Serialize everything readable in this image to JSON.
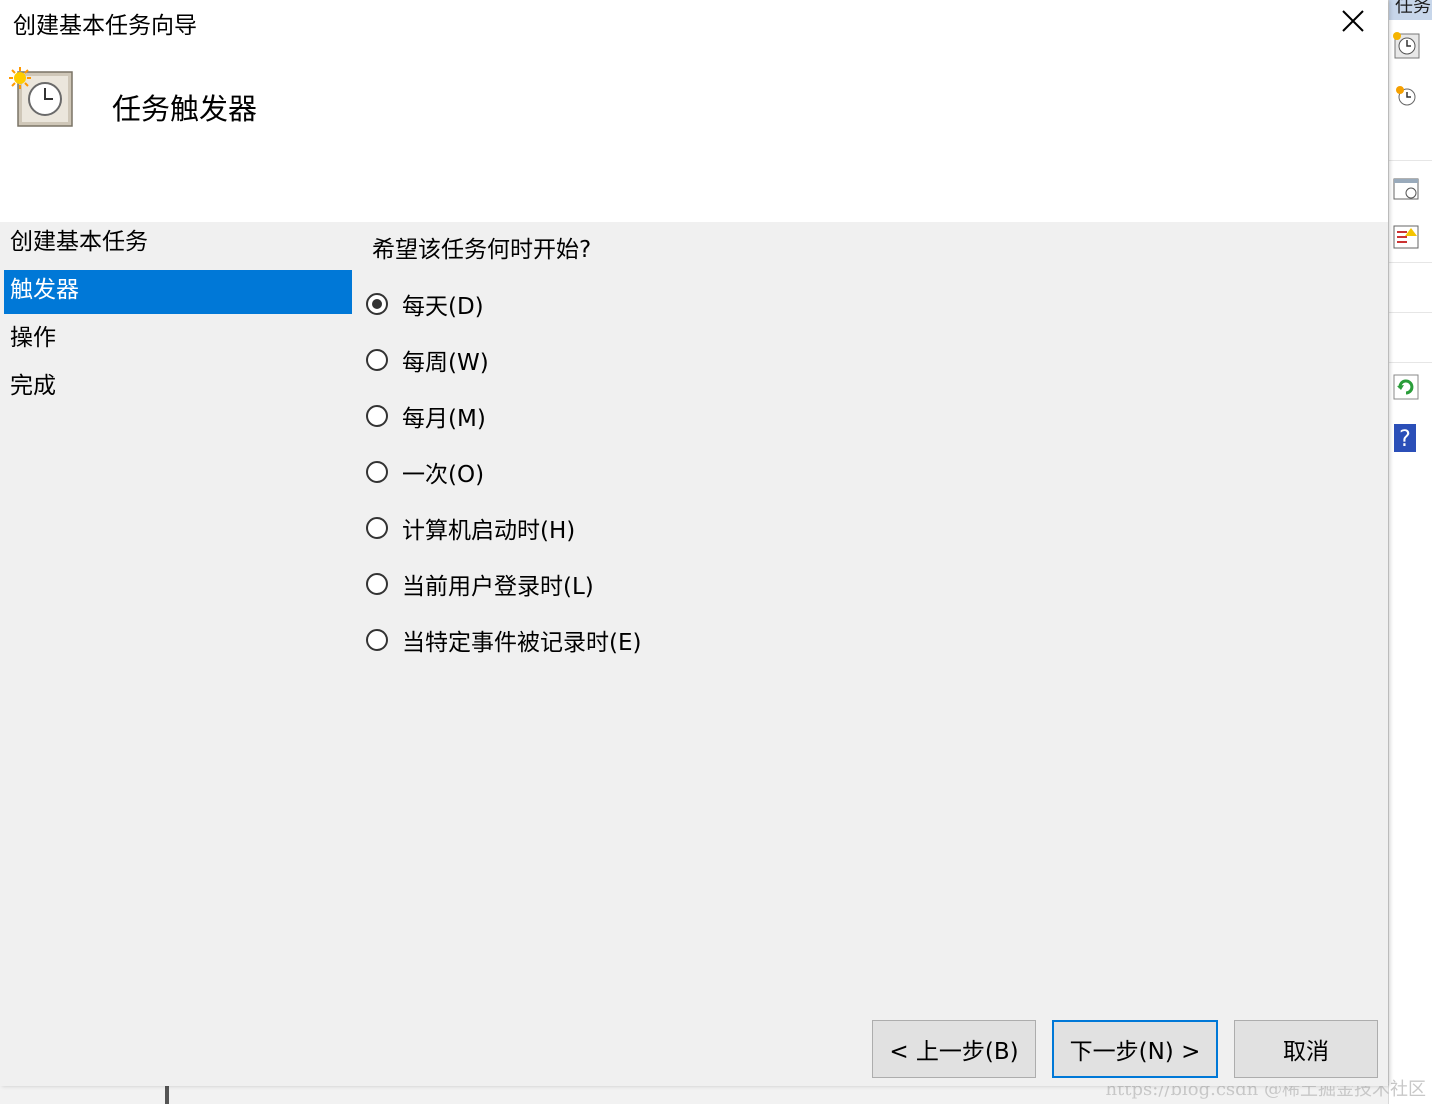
{
  "dialog": {
    "title": "创建基本任务向导",
    "header_title": "任务触发器"
  },
  "steps": [
    {
      "label": "创建基本任务",
      "active": false
    },
    {
      "label": "触发器",
      "active": true
    },
    {
      "label": "操作",
      "active": false
    },
    {
      "label": "完成",
      "active": false
    }
  ],
  "content": {
    "question": "希望该任务何时开始?",
    "options": [
      {
        "label": "每天(D)",
        "checked": true
      },
      {
        "label": "每周(W)",
        "checked": false
      },
      {
        "label": "每月(M)",
        "checked": false
      },
      {
        "label": "一次(O)",
        "checked": false
      },
      {
        "label": "计算机启动时(H)",
        "checked": false
      },
      {
        "label": "当前用户登录时(L)",
        "checked": false
      },
      {
        "label": "当特定事件被记录时(E)",
        "checked": false
      }
    ]
  },
  "buttons": {
    "back": "< 上一步(B)",
    "next": "下一步(N) >",
    "cancel": "取消"
  },
  "background_app": {
    "title_fragment": "任务"
  },
  "watermark": "https://blog.csdn @稀土掘金技术社区",
  "colors": {
    "accent": "#0078d7",
    "dialog_bg": "#f0f0f0",
    "header_bg": "#ffffff"
  }
}
